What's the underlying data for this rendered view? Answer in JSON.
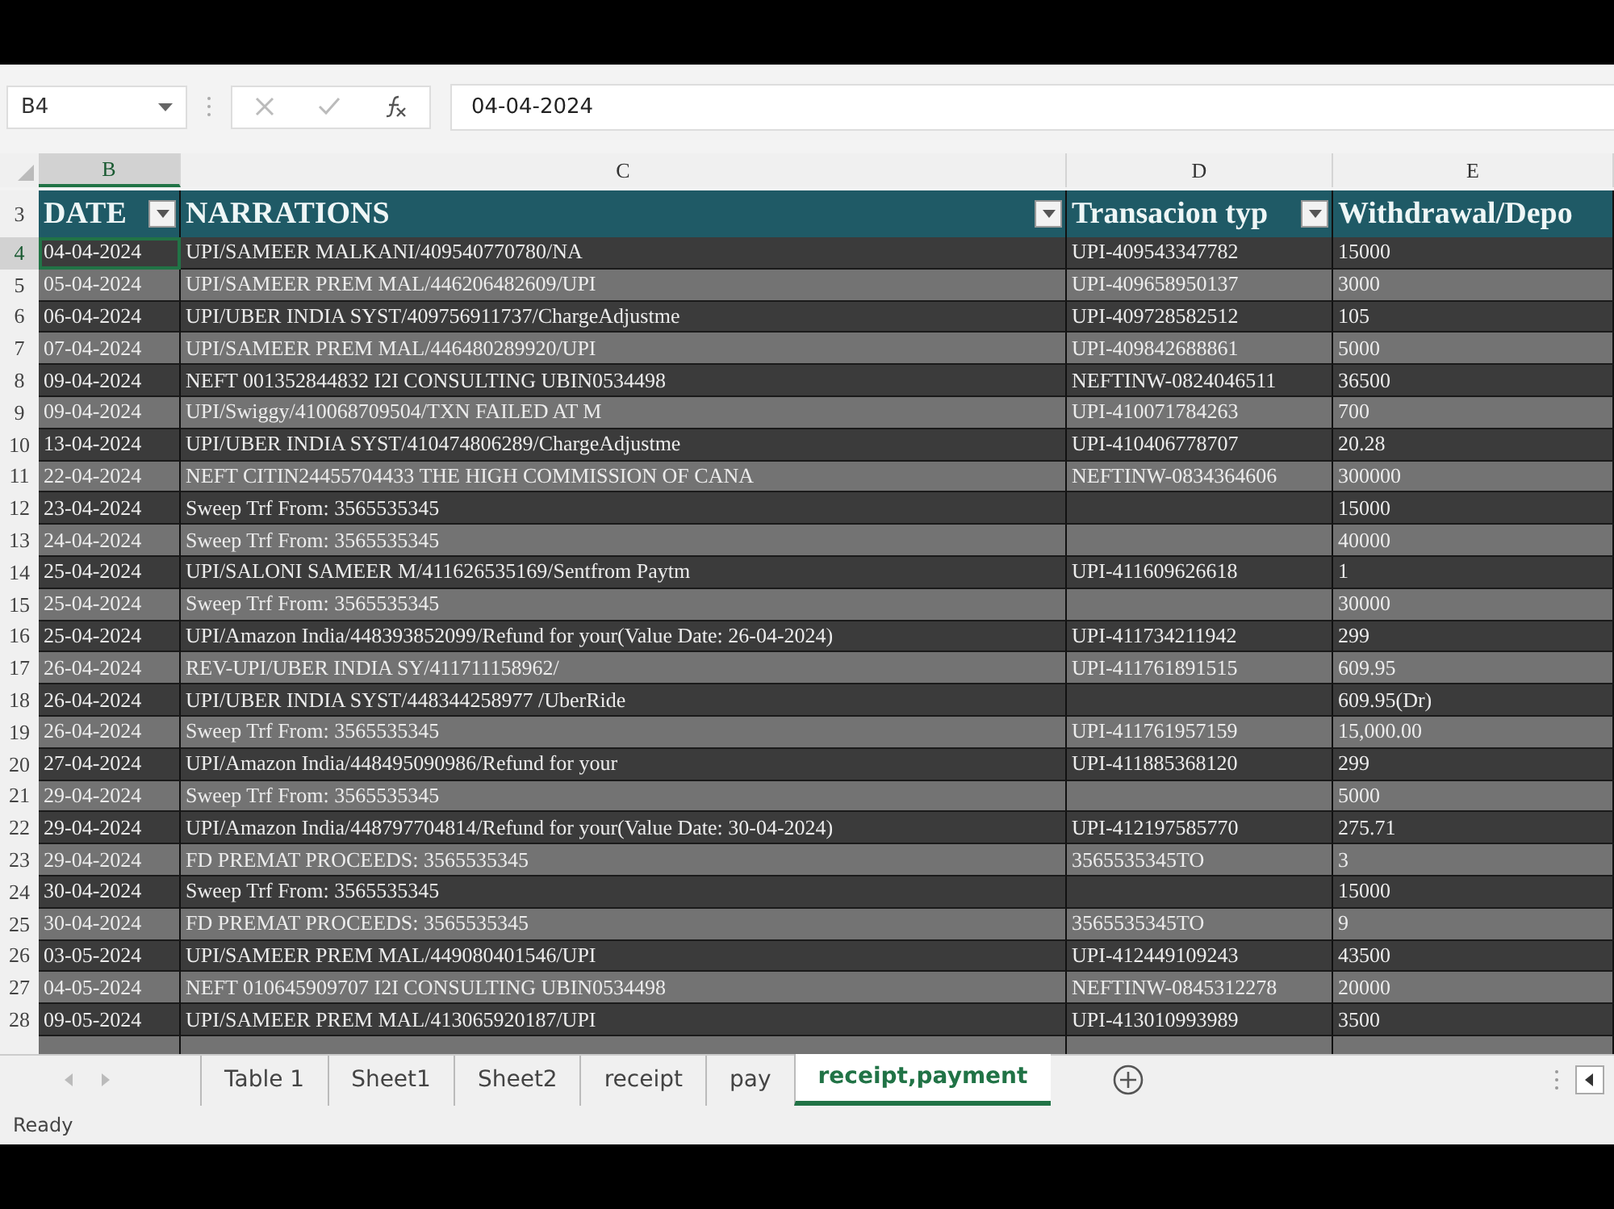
{
  "formula_bar": {
    "name_box": "B4",
    "value": "04-04-2024"
  },
  "column_headers": [
    {
      "label": "B",
      "selected": true
    },
    {
      "label": "C",
      "selected": false
    },
    {
      "label": "D",
      "selected": false
    },
    {
      "label": "E",
      "selected": false
    }
  ],
  "table": {
    "header_row": "3",
    "columns": [
      {
        "label": "DATE",
        "filter": true
      },
      {
        "label": "NARRATIONS",
        "filter": true
      },
      {
        "label": "Transacion typ",
        "filter": true
      },
      {
        "label": "Withdrawal/Depo",
        "filter": false
      }
    ],
    "rows": [
      {
        "number": "4",
        "selected": true,
        "cells": [
          "04-04-2024",
          "UPI/SAMEER MALKANI/409540770780/NA",
          "UPI-409543347782",
          "15000"
        ]
      },
      {
        "number": "5",
        "selected": false,
        "cells": [
          "05-04-2024",
          "UPI/SAMEER PREM MAL/446206482609/UPI",
          "UPI-409658950137",
          "3000"
        ]
      },
      {
        "number": "6",
        "selected": false,
        "cells": [
          "06-04-2024",
          "UPI/UBER INDIA SYST/409756911737/ChargeAdjustme",
          "UPI-409728582512",
          "105"
        ]
      },
      {
        "number": "7",
        "selected": false,
        "cells": [
          "07-04-2024",
          "UPI/SAMEER PREM MAL/446480289920/UPI",
          "UPI-409842688861",
          "5000"
        ]
      },
      {
        "number": "8",
        "selected": false,
        "cells": [
          "09-04-2024",
          "NEFT 001352844832 I2I CONSULTING UBIN0534498",
          "NEFTINW-0824046511",
          "36500"
        ]
      },
      {
        "number": "9",
        "selected": false,
        "cells": [
          "09-04-2024",
          "UPI/Swiggy/410068709504/TXN FAILED AT M",
          "UPI-410071784263",
          "700"
        ]
      },
      {
        "number": "10",
        "selected": false,
        "cells": [
          "13-04-2024",
          "UPI/UBER INDIA SYST/410474806289/ChargeAdjustme",
          "UPI-410406778707",
          "20.28"
        ]
      },
      {
        "number": "11",
        "selected": false,
        "cells": [
          "22-04-2024",
          "NEFT CITIN24455704433 THE HIGH COMMISSION OF CANA",
          "NEFTINW-0834364606",
          "300000"
        ]
      },
      {
        "number": "12",
        "selected": false,
        "cells": [
          "23-04-2024",
          "Sweep Trf From: 3565535345",
          "",
          "15000"
        ]
      },
      {
        "number": "13",
        "selected": false,
        "cells": [
          "24-04-2024",
          "Sweep Trf From: 3565535345",
          "",
          "40000"
        ]
      },
      {
        "number": "14",
        "selected": false,
        "cells": [
          "25-04-2024",
          "UPI/SALONI SAMEER M/411626535169/Sentfrom Paytm",
          "UPI-411609626618",
          "1"
        ]
      },
      {
        "number": "15",
        "selected": false,
        "cells": [
          "25-04-2024",
          "Sweep Trf From: 3565535345",
          "",
          "30000"
        ]
      },
      {
        "number": "16",
        "selected": false,
        "cells": [
          "25-04-2024",
          "UPI/Amazon India/448393852099/Refund for your(Value Date: 26-04-2024)",
          "UPI-411734211942",
          "299"
        ]
      },
      {
        "number": "17",
        "selected": false,
        "cells": [
          "26-04-2024",
          "REV-UPI/UBER INDIA SY/411711158962/",
          "UPI-411761891515",
          "609.95"
        ]
      },
      {
        "number": "18",
        "selected": false,
        "cells": [
          "26-04-2024",
          "UPI/UBER INDIA SYST/448344258977 /UberRide",
          "",
          "609.95(Dr)"
        ]
      },
      {
        "number": "19",
        "selected": false,
        "cells": [
          "26-04-2024",
          "Sweep Trf From: 3565535345",
          "UPI-411761957159",
          "15,000.00"
        ]
      },
      {
        "number": "20",
        "selected": false,
        "cells": [
          "27-04-2024",
          "UPI/Amazon India/448495090986/Refund for your",
          "UPI-411885368120",
          "299"
        ]
      },
      {
        "number": "21",
        "selected": false,
        "cells": [
          "29-04-2024",
          "Sweep Trf From: 3565535345",
          "",
          "5000"
        ]
      },
      {
        "number": "22",
        "selected": false,
        "cells": [
          "29-04-2024",
          "UPI/Amazon India/448797704814/Refund for your(Value Date: 30-04-2024)",
          "UPI-412197585770",
          "275.71"
        ]
      },
      {
        "number": "23",
        "selected": false,
        "cells": [
          "29-04-2024",
          "FD PREMAT PROCEEDS: 3565535345",
          "3565535345TO",
          "3"
        ]
      },
      {
        "number": "24",
        "selected": false,
        "cells": [
          "30-04-2024",
          "Sweep Trf From: 3565535345",
          "",
          "15000"
        ]
      },
      {
        "number": "25",
        "selected": false,
        "cells": [
          "30-04-2024",
          "FD PREMAT PROCEEDS: 3565535345",
          "3565535345TO",
          "9"
        ]
      },
      {
        "number": "26",
        "selected": false,
        "cells": [
          "03-05-2024",
          "UPI/SAMEER PREM MAL/449080401546/UPI",
          "UPI-412449109243",
          "43500"
        ]
      },
      {
        "number": "27",
        "selected": false,
        "cells": [
          "04-05-2024",
          "NEFT 010645909707 I2I CONSULTING UBIN0534498",
          "NEFTINW-0845312278",
          "20000"
        ]
      },
      {
        "number": "28",
        "selected": false,
        "cells": [
          "09-05-2024",
          "UPI/SAMEER PREM MAL/413065920187/UPI",
          "UPI-413010993989",
          "3500"
        ]
      }
    ]
  },
  "sheet_tabs": [
    {
      "label": "Table 1",
      "selected": false
    },
    {
      "label": "Sheet1",
      "selected": false
    },
    {
      "label": "Sheet2",
      "selected": false
    },
    {
      "label": "receipt",
      "selected": false
    },
    {
      "label": "pay",
      "selected": false
    },
    {
      "label": "receipt,payment",
      "selected": true
    }
  ],
  "status_bar": {
    "text": "Ready"
  }
}
